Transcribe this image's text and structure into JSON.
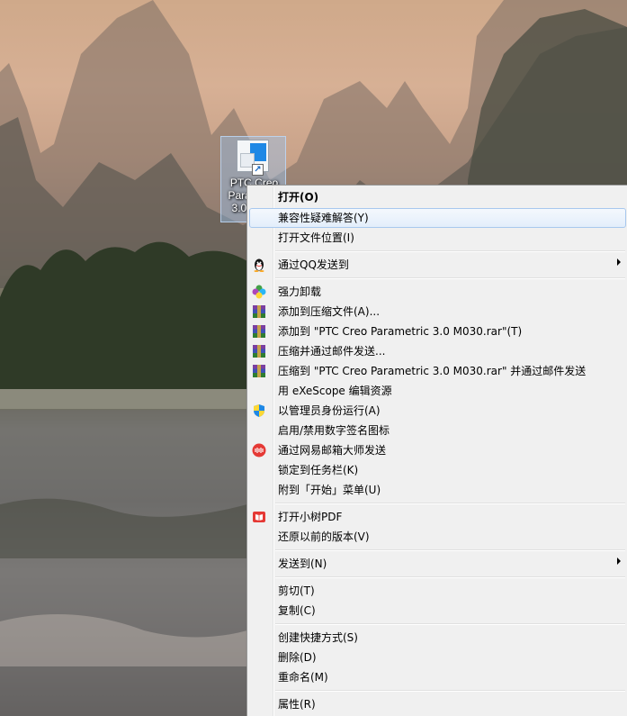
{
  "desktop": {
    "icon_label": "PTC Creo\nParametric\n3.0 M030"
  },
  "context_menu": {
    "items": [
      {
        "label": "打开(O)",
        "bold": true,
        "icon": null,
        "submenu": false
      },
      {
        "label": "兼容性疑难解答(Y)",
        "highlighted": true,
        "icon": null,
        "submenu": false
      },
      {
        "label": "打开文件位置(I)",
        "icon": null,
        "submenu": false
      },
      {
        "label": "通过QQ发送到",
        "icon": "qq-penguin-icon",
        "submenu": true
      },
      {
        "label": "强力卸载",
        "icon": "uninstall-clover-icon",
        "submenu": false
      },
      {
        "label": "添加到压缩文件(A)...",
        "icon": "winrar-icon",
        "submenu": false
      },
      {
        "label": "添加到 \"PTC Creo Parametric 3.0 M030.rar\"(T)",
        "icon": "winrar-icon",
        "submenu": false
      },
      {
        "label": "压缩并通过邮件发送...",
        "icon": "winrar-icon",
        "submenu": false
      },
      {
        "label": "压缩到 \"PTC Creo Parametric 3.0 M030.rar\" 并通过邮件发送",
        "icon": "winrar-icon",
        "submenu": false
      },
      {
        "label": "用 eXeScope 编辑资源",
        "icon": null,
        "submenu": false
      },
      {
        "label": "以管理员身份运行(A)",
        "icon": "uac-shield-icon",
        "submenu": false
      },
      {
        "label": "启用/禁用数字签名图标",
        "icon": null,
        "submenu": false
      },
      {
        "label": "通过网易邮箱大师发送",
        "icon": "netease-mail-icon",
        "submenu": false
      },
      {
        "label": "锁定到任务栏(K)",
        "icon": null,
        "submenu": false
      },
      {
        "label": "附到「开始」菜单(U)",
        "icon": null,
        "submenu": false
      },
      {
        "label": "打开小树PDF",
        "icon": "pdf-book-icon",
        "submenu": false
      },
      {
        "label": "还原以前的版本(V)",
        "icon": null,
        "submenu": false
      },
      {
        "label": "发送到(N)",
        "icon": null,
        "submenu": true
      },
      {
        "label": "剪切(T)",
        "icon": null,
        "submenu": false
      },
      {
        "label": "复制(C)",
        "icon": null,
        "submenu": false
      },
      {
        "label": "创建快捷方式(S)",
        "icon": null,
        "submenu": false
      },
      {
        "label": "删除(D)",
        "icon": null,
        "submenu": false
      },
      {
        "label": "重命名(M)",
        "icon": null,
        "submenu": false
      },
      {
        "label": "属性(R)",
        "icon": null,
        "submenu": false
      }
    ]
  },
  "colors": {
    "menu_bg": "#f0f0f0",
    "highlight_border": "#a8c8ee",
    "qq_black": "#111111",
    "winrar_purple": "#7b3fa0",
    "netease_red": "#e53935",
    "pdf_red": "#e53935"
  }
}
